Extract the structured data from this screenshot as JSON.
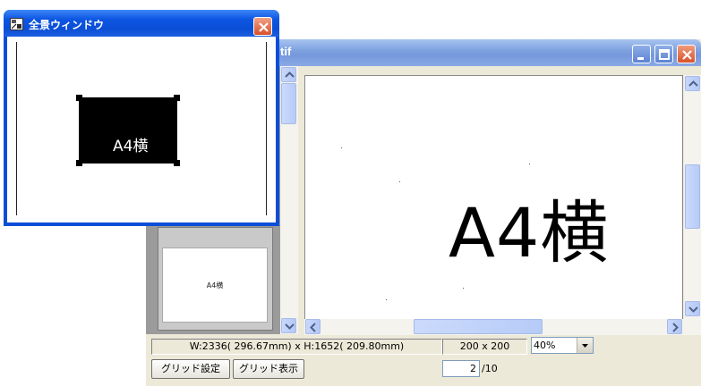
{
  "overview_window": {
    "title": "全景ウィンドウ",
    "icon": "overview-app-icon",
    "close_icon": "close-icon",
    "preview_text": "A4横"
  },
  "main_window": {
    "title_partial": "tif",
    "controls": [
      "minimize-icon",
      "maximize-icon",
      "close-icon"
    ]
  },
  "thumbnail": {
    "text": "A4横"
  },
  "canvas": {
    "text": "A4横"
  },
  "status": {
    "dimensions": "W:2336( 296.67mm) x H:1652( 209.80mm)",
    "grid_size": "200 x 200",
    "zoom": "40%"
  },
  "toolbar": {
    "grid_settings_label": "グリッド設定",
    "grid_show_label": "グリッド表示",
    "page_current": "2",
    "page_total": "/10"
  },
  "colors": {
    "xp_title_active": "#0a4ed6",
    "xp_title_inactive": "#7698dc",
    "window_face": "#ece9d8"
  }
}
